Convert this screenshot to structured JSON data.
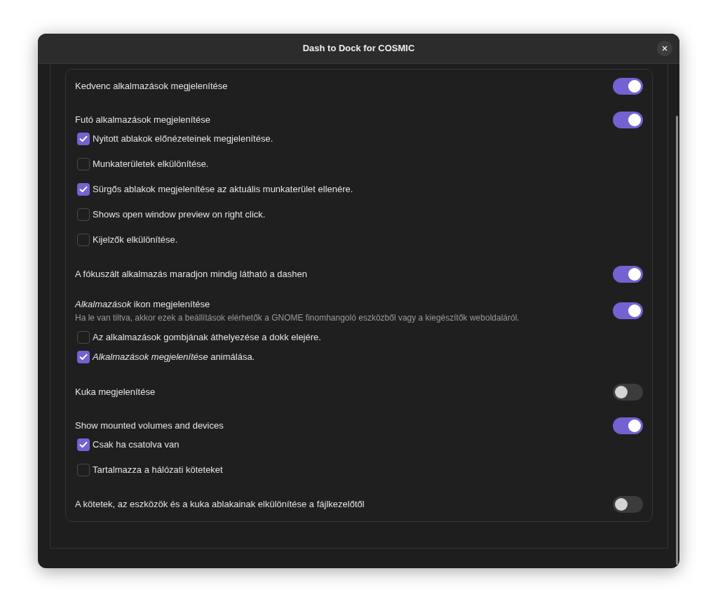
{
  "window": {
    "title": "Dash to Dock for COSMIC"
  },
  "rows": [
    {
      "kind": "switch",
      "label": "Kedvenc alkalmazások megjelenítése",
      "on": true
    },
    {
      "kind": "switch",
      "label": "Futó alkalmazások megjelenítése",
      "on": true,
      "children": [
        {
          "kind": "checkbox",
          "label": "Nyitott ablakok előnézeteinek megjelenítése.",
          "checked": true
        },
        {
          "kind": "checkbox",
          "label": "Munkaterületek elkülönítése.",
          "checked": false
        },
        {
          "kind": "checkbox",
          "label": "Sürgős ablakok megjelenítése az aktuális munkaterület ellenére.",
          "checked": true
        },
        {
          "kind": "checkbox",
          "label": "Shows open window preview on right click.",
          "checked": false
        },
        {
          "kind": "checkbox",
          "label": "Kijelzők elkülönítése.",
          "checked": false
        }
      ]
    },
    {
      "kind": "switch",
      "label": "A fókuszált alkalmazás maradjon mindig látható a dashen",
      "on": true
    },
    {
      "kind": "switch",
      "label": "*Alkalmazások* ikon megjelenítése",
      "subtitle": "Ha le van tiltva, akkor ezek a beállítások elérhetők a GNOME finomhangoló eszközből vagy a kiegészítők weboldaláról.",
      "on": true,
      "children": [
        {
          "kind": "checkbox",
          "label": "Az alkalmazások gombjának áthelyezése a dokk elejére.",
          "checked": false
        },
        {
          "kind": "checkbox",
          "label": "*Alkalmazások megjelenítése* animálása.",
          "checked": true
        }
      ]
    },
    {
      "kind": "switch",
      "label": "Kuka megjelenítése",
      "on": false
    },
    {
      "kind": "switch",
      "label": "Show mounted volumes and devices",
      "on": true,
      "children": [
        {
          "kind": "checkbox",
          "label": "Csak ha csatolva van",
          "checked": true
        },
        {
          "kind": "checkbox",
          "label": "Tartalmazza a hálózati köteteket",
          "checked": false
        }
      ]
    },
    {
      "kind": "switch",
      "label": "A kötetek, az eszközök és a kuka ablakainak elkülönítése a fájlkezelőtől",
      "on": false
    }
  ]
}
